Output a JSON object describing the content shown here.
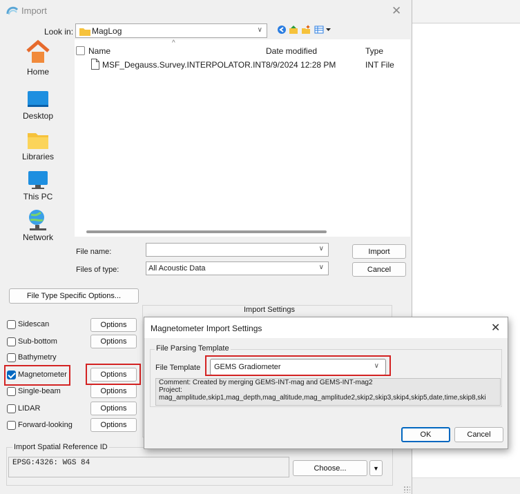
{
  "dialog": {
    "title": "Import",
    "look_in_label": "Look in:",
    "look_in_value": "MagLog",
    "places": [
      {
        "label": "Home",
        "icon": "home-icon"
      },
      {
        "label": "Desktop",
        "icon": "desktop-icon"
      },
      {
        "label": "Libraries",
        "icon": "libraries-icon"
      },
      {
        "label": "This PC",
        "icon": "this-pc-icon"
      },
      {
        "label": "Network",
        "icon": "network-icon"
      }
    ],
    "columns": {
      "name": "Name",
      "date": "Date modified",
      "type": "Type"
    },
    "files": [
      {
        "name": "MSF_Degauss.Survey.INTERPOLATOR.INT",
        "date": "8/9/2024 12:28 PM",
        "type": "INT File"
      }
    ],
    "file_name_label": "File name:",
    "file_name_value": "",
    "files_of_type_label": "Files of type:",
    "files_of_type_value": "All Acoustic Data",
    "import_button": "Import",
    "cancel_button": "Cancel",
    "file_type_options_button": "File Type Specific Options...",
    "import_settings_title": "Import Settings",
    "options_label": "Options",
    "data_types": [
      {
        "label": "Sidescan",
        "checked": false
      },
      {
        "label": "Sub-bottom",
        "checked": false
      },
      {
        "label": "Bathymetry",
        "checked": false
      },
      {
        "label": "Magnetometer",
        "checked": true
      },
      {
        "label": "Single-beam",
        "checked": false
      },
      {
        "label": "LIDAR",
        "checked": false
      },
      {
        "label": "Forward-looking",
        "checked": false
      }
    ],
    "spatial_ref_title": "Import Spatial Reference ID",
    "spatial_ref_value": "EPSG:4326: WGS 84",
    "choose_button": "Choose..."
  },
  "mag_dialog": {
    "title": "Magnetometer Import Settings",
    "group_title": "File Parsing Template",
    "file_template_label": "File Template",
    "file_template_value": "GEMS Gradiometer",
    "comment_line1": "Comment: Created by merging GEMS-INT-mag and GEMS-INT-mag2",
    "comment_line2": "Project:",
    "comment_line3": "mag_amplitude,skip1,mag_depth,mag_altitude,mag_amplitude2,skip2,skip3,skip4,skip5,date,time,skip8,ski",
    "ok_button": "OK",
    "cancel_button": "Cancel"
  },
  "colors": {
    "accent": "#0067c0",
    "highlight": "#d32222",
    "folder": "#f6c23b"
  }
}
